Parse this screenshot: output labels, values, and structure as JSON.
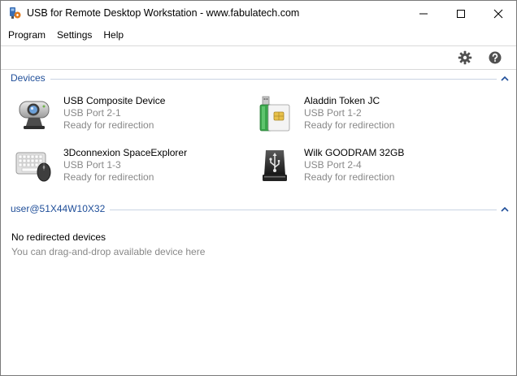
{
  "window": {
    "title": "USB for Remote Desktop Workstation - www.fabulatech.com"
  },
  "menu": [
    "Program",
    "Settings",
    "Help"
  ],
  "toolbar": {
    "settings_icon": "gear-icon",
    "help_icon": "help-icon"
  },
  "sections": {
    "devices": {
      "title": "Devices",
      "items": [
        {
          "name": "USB Composite Device",
          "port": "USB Port   2-1",
          "status": "Ready for redirection",
          "icon": "webcam-icon"
        },
        {
          "name": "Aladdin Token JC",
          "port": "USB Port   1-2",
          "status": "Ready for redirection",
          "icon": "token-icon"
        },
        {
          "name": "3Dconnexion SpaceExplorer",
          "port": "USB Port   1-3",
          "status": "Ready for redirection",
          "icon": "keyboard-mouse-icon"
        },
        {
          "name": "Wilk GOODRAM 32GB",
          "port": "USB Port   2-4",
          "status": "Ready for redirection",
          "icon": "usb-drive-icon"
        }
      ]
    },
    "remote": {
      "title": "user@51X44W10X32",
      "empty_title": "No redirected devices",
      "empty_hint": "You can drag-and-drop available device here"
    }
  },
  "colors": {
    "section_title": "#1f4e99",
    "secondary_text": "#888888"
  }
}
